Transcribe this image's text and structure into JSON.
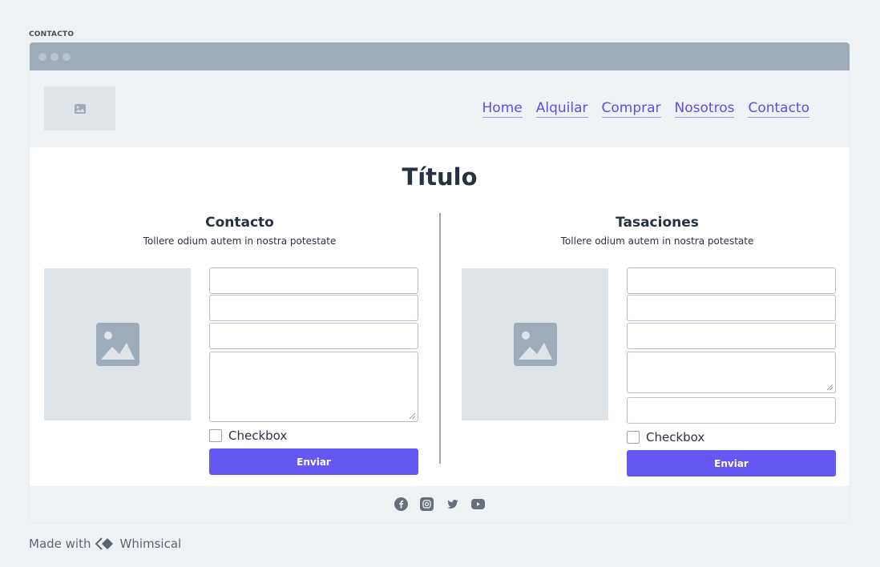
{
  "frame": {
    "label": "CONTACTO"
  },
  "header": {
    "logo_icon": "image-icon",
    "nav": [
      "Home",
      "Alquilar",
      "Comprar",
      "Nosotros",
      "Contacto"
    ]
  },
  "main": {
    "title": "Título",
    "columns": [
      {
        "title": "Contacto",
        "subtitle": "Tollere odium autem in nostra potestate",
        "checkbox_label": "Checkbox",
        "button_label": "Enviar"
      },
      {
        "title": "Tasaciones",
        "subtitle": "Tollere odium autem in nostra potestate",
        "checkbox_label": "Checkbox",
        "button_label": "Enviar"
      }
    ]
  },
  "footer": {
    "icons": [
      "facebook-icon",
      "instagram-icon",
      "twitter-icon",
      "youtube-icon"
    ]
  },
  "made_with": {
    "prefix": "Made with",
    "brand": "Whimsical"
  },
  "colors": {
    "accent": "#6557f2",
    "link": "#5b4fe6",
    "titlebar": "#9eacb9",
    "placeholder": "#dfe4e9"
  }
}
